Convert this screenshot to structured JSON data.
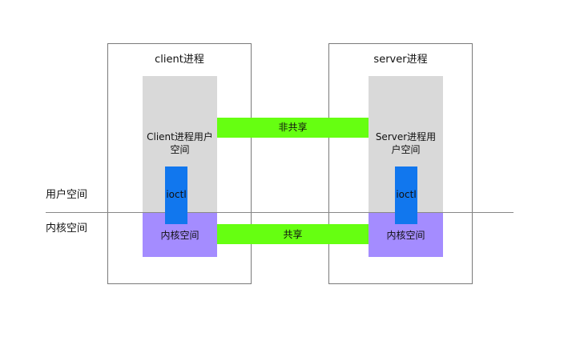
{
  "left_labels": {
    "user_space": "用户空间",
    "kernel_space": "内核空间"
  },
  "client": {
    "title": "client进程",
    "user_space_label": "Client进程用户空间",
    "ioctl": "ioctl",
    "kernel_label": "内核空间"
  },
  "server": {
    "title": "server进程",
    "user_space_label": "Server进程用户空间",
    "ioctl": "ioctl",
    "kernel_label": "内核空间"
  },
  "links": {
    "non_shared": "非共享",
    "shared": "共享"
  },
  "colors": {
    "user_area": "#d9d9d9",
    "kernel_area": "#a48cff",
    "bar": "#66ff11",
    "ioctl": "#1177ee",
    "box_border": "#7a7a7a",
    "divider": "#888888"
  }
}
